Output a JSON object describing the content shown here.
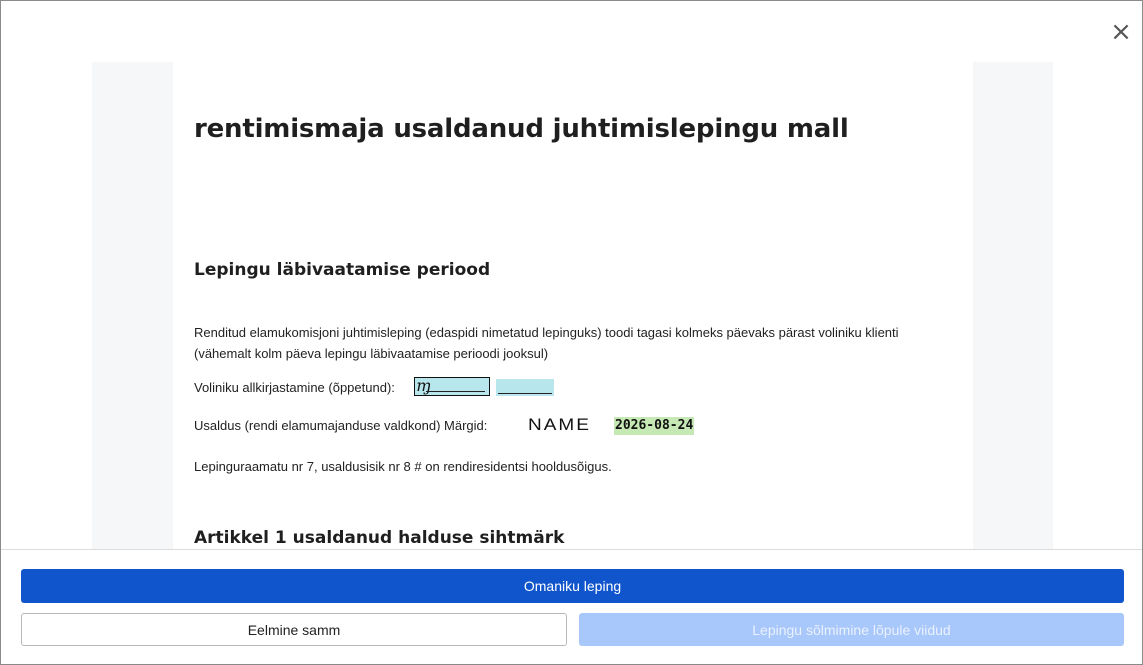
{
  "dialog": {
    "close_icon": "close-icon"
  },
  "document": {
    "title": "rentimismaja usaldanud juhtimislepingu mall",
    "section1": {
      "heading": "Lepingu läbivaatamise periood",
      "paragraph": "Renditud elamukomisjoni juhtimisleping (edaspidi nimetatud lepinguks) toodi tagasi kolmeks päevaks pärast voliniku klienti (vähemalt kolm päeva lepingu läbivaatamise perioodi jooksul)",
      "signature_label": "Voliniku allkirjastamine (õppetund):",
      "trust_label": "Usaldus (rendi elamumajanduse valdkond) Märgid:",
      "name_stamp": "NAME",
      "date": "2026-08-24",
      "note": "Lepinguraamatu nr 7, usaldusisik nr 8 # on rendiresidentsi hooldusõigus."
    },
    "section2": {
      "heading": "Artikkel 1 usaldanud halduse sihtmärk"
    }
  },
  "footer": {
    "primary_label": "Omaniku leping",
    "back_label": "Eelmine samm",
    "finish_label": "Lepingu sõlmimine lõpule viidud"
  },
  "colors": {
    "primary": "#1155cc",
    "disabled": "#a8c7fa",
    "signature_field": "#b7e6ec",
    "date_highlight": "#c6e8b4"
  }
}
